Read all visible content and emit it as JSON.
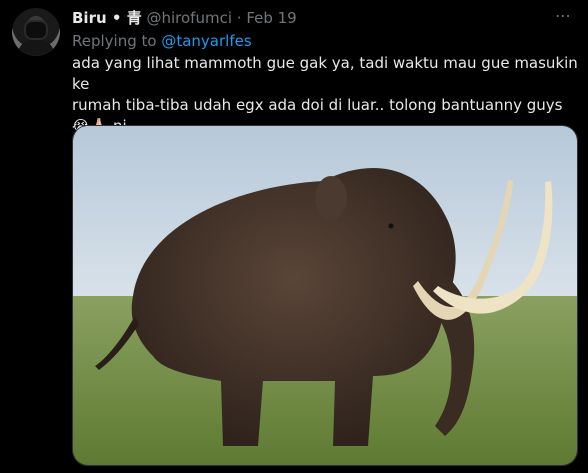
{
  "author": {
    "display_name": "Biru",
    "name_suffix": " • 青",
    "handle": "@hirofumci",
    "separator": " · ",
    "date": "Feb 19"
  },
  "more_icon": "⋯",
  "reply": {
    "prefix": "Replying to ",
    "handle": "@tanyarlfes"
  },
  "text": "ada yang lihat mammoth gue gak ya, tadi waktu mau gue masukin ke\nrumah tiba-tiba udah egx ada doi di luar.. tolong bantuanny guys 😭🙏🏻 ni\nmammoth yang ngasih kakek w",
  "media": {
    "icon": "photo",
    "sky_top": "#b9c9d8",
    "grass": "#6f8a3e"
  }
}
